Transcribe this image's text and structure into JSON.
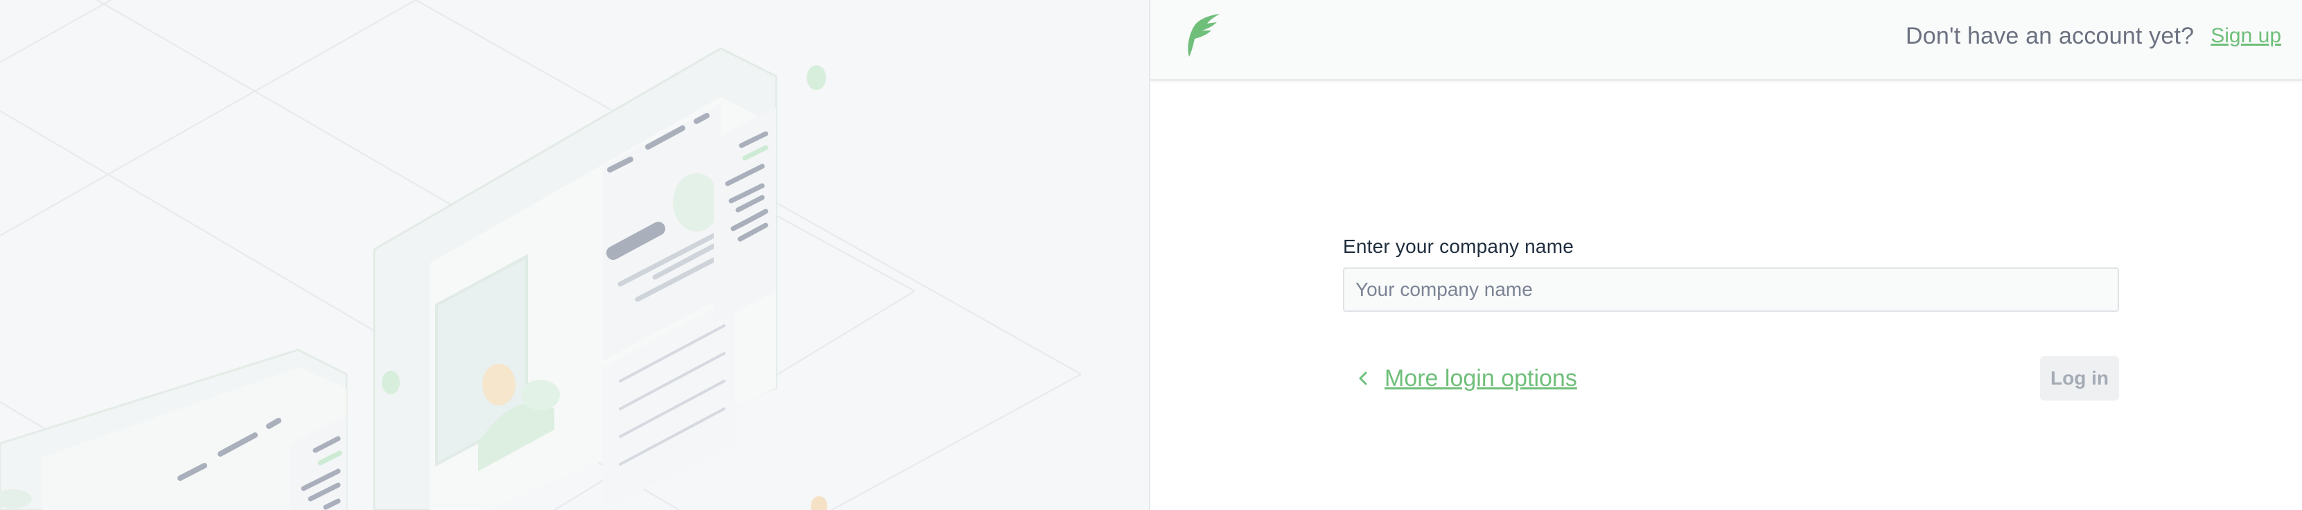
{
  "header": {
    "logo_icon": "feather-f-logo",
    "signup_prompt": "Don't have an account yet?",
    "signup_link": "Sign up"
  },
  "form": {
    "company_label": "Enter your company name",
    "company_placeholder": "Your company name",
    "company_value": "",
    "more_options_icon": "chevron-left-icon",
    "more_options_label": "More login options",
    "login_button": "Log in"
  },
  "illustration": {
    "description_icon": "isometric-dashboard-illustration"
  },
  "colors": {
    "brand_green": "#6fbf7a",
    "text_dark": "#1f2d3d",
    "text_muted": "#6b7180",
    "panel_bg": "#f5f7f8",
    "disabled_button_bg": "#eef0f2"
  }
}
